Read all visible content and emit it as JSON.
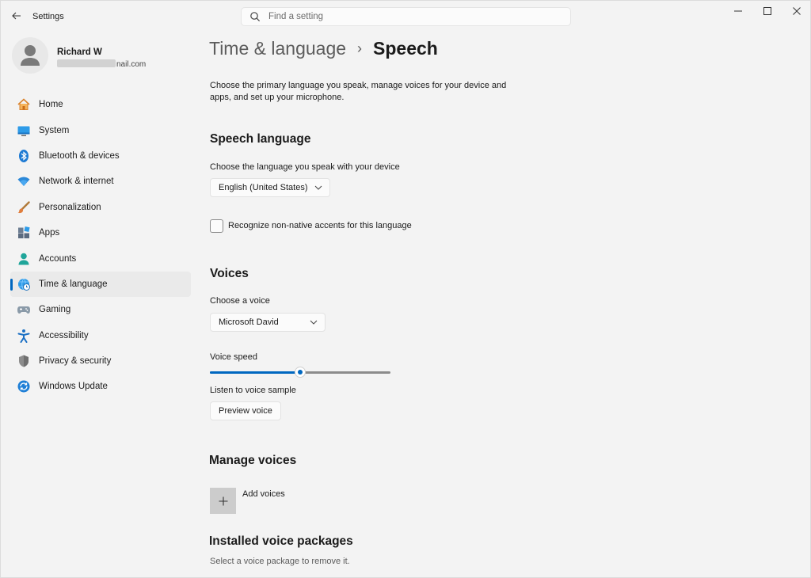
{
  "app": {
    "title": "Settings"
  },
  "search": {
    "placeholder": "Find a setting"
  },
  "profile": {
    "name": "Richard W",
    "email_suffix": "nail.com"
  },
  "nav": {
    "items": [
      {
        "label": "Home",
        "icon": "home-icon"
      },
      {
        "label": "System",
        "icon": "system-icon"
      },
      {
        "label": "Bluetooth & devices",
        "icon": "bluetooth-icon"
      },
      {
        "label": "Network & internet",
        "icon": "wifi-icon"
      },
      {
        "label": "Personalization",
        "icon": "brush-icon"
      },
      {
        "label": "Apps",
        "icon": "apps-icon"
      },
      {
        "label": "Accounts",
        "icon": "accounts-icon"
      },
      {
        "label": "Time & language",
        "icon": "globe-clock-icon",
        "active": true
      },
      {
        "label": "Gaming",
        "icon": "gamepad-icon"
      },
      {
        "label": "Accessibility",
        "icon": "accessibility-icon"
      },
      {
        "label": "Privacy & security",
        "icon": "shield-icon"
      },
      {
        "label": "Windows Update",
        "icon": "update-icon"
      }
    ]
  },
  "breadcrumb": {
    "parent": "Time & language",
    "separator": "›",
    "current": "Speech"
  },
  "intro": "Choose the primary language you speak, manage voices for your device and apps, and set up your microphone.",
  "speech_language": {
    "heading": "Speech language",
    "label": "Choose the language you speak with your device",
    "selected": "English (United States)",
    "accents_checkbox": {
      "label": "Recognize non-native accents for this language",
      "checked": false
    }
  },
  "voices": {
    "heading": "Voices",
    "choose_label": "Choose a voice",
    "selected": "Microsoft David",
    "speed_label": "Voice speed",
    "speed_fraction": 0.5,
    "sample_label": "Listen to voice sample",
    "preview_button": "Preview voice"
  },
  "manage_voices": {
    "heading": "Manage voices",
    "add_label": "Add voices"
  },
  "installed": {
    "heading": "Installed voice packages",
    "hint": "Select a voice package to remove it."
  },
  "colors": {
    "accent": "#0067c0",
    "background": "#f3f3f3"
  }
}
